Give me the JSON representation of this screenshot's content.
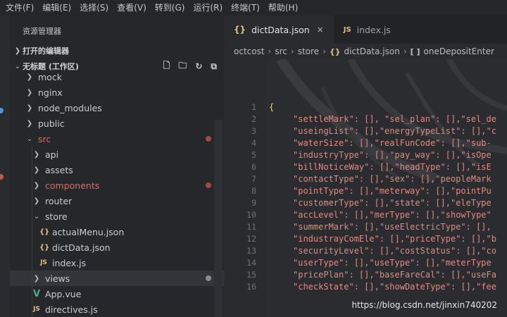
{
  "menu": [
    "文件(F)",
    "编辑(E)",
    "选择(S)",
    "查看(V)",
    "转到(G)",
    "运行(R)",
    "终端(T)",
    "帮助(H)"
  ],
  "sidebar": {
    "title": "资源管理器",
    "open_editors": "打开的编辑器",
    "workspace": "无标题 (工作区)",
    "tree": [
      {
        "label": "mock",
        "kind": "folder",
        "depth": 0,
        "expanded": false
      },
      {
        "label": "nginx",
        "kind": "folder",
        "depth": 0,
        "expanded": false
      },
      {
        "label": "node_modules",
        "kind": "folder",
        "depth": 0,
        "expanded": false
      },
      {
        "label": "public",
        "kind": "folder",
        "depth": 0,
        "expanded": false
      },
      {
        "label": "src",
        "kind": "folder",
        "depth": 0,
        "expanded": true,
        "modified": true
      },
      {
        "label": "api",
        "kind": "folder",
        "depth": 1,
        "expanded": false
      },
      {
        "label": "assets",
        "kind": "folder",
        "depth": 1,
        "expanded": false
      },
      {
        "label": "components",
        "kind": "folder",
        "depth": 1,
        "expanded": false,
        "modified": true
      },
      {
        "label": "router",
        "kind": "folder",
        "depth": 1,
        "expanded": false
      },
      {
        "label": "store",
        "kind": "folder",
        "depth": 1,
        "expanded": true
      },
      {
        "label": "actualMenu.json",
        "kind": "json",
        "depth": 2
      },
      {
        "label": "dictData.json",
        "kind": "json",
        "depth": 2
      },
      {
        "label": "index.js",
        "kind": "js",
        "depth": 2
      },
      {
        "label": "views",
        "kind": "folder",
        "depth": 1,
        "expanded": false,
        "selected": true,
        "dot": true
      },
      {
        "label": "App.vue",
        "kind": "vue",
        "depth": 1
      },
      {
        "label": "directives.js",
        "kind": "js",
        "depth": 1
      }
    ]
  },
  "tabs": [
    {
      "label": "dictData.json",
      "icon": "json-icon",
      "active": true,
      "close": "×"
    },
    {
      "label": "index.js",
      "icon": "js-icon",
      "active": false
    }
  ],
  "breadcrumb": [
    "octcost",
    "src",
    "store",
    "dictData.json",
    "oneDepositEnter"
  ],
  "code": {
    "line_numbers": [
      "1",
      "2",
      "3",
      "4",
      "5",
      "6",
      "7",
      "8",
      "9",
      "10",
      "11",
      "12",
      "13",
      "14",
      "15",
      "16"
    ],
    "lines": [
      {
        "t": "{",
        "brace": true
      },
      {
        "t": "\"settleMark\": [], \"sel_plan\": [],\"sel_de"
      },
      {
        "t": "\"useingList\": [],\"energyTypeList\": [],\"c"
      },
      {
        "t": "\"waterSize\": [],\"realFunCode\": [],\"sub-"
      },
      {
        "t": "\"industryType\": [],\"pay_way\": [],\"isOpe"
      },
      {
        "t": "\"billNoticeWay\": [],\"headType\": [],\"isE"
      },
      {
        "t": "\"contactType\": [],\"sex\": [],\"peopleMark"
      },
      {
        "t": "\"pointType\": [],\"meterway\": [],\"pointPu"
      },
      {
        "t": "\"customerType\": [],\"state\": [],\"eleType"
      },
      {
        "t": "\"accLevel\": [],\"merType\": [],\"showType\""
      },
      {
        "t": "\"summerMark\": [],\"useElectricType\": [],"
      },
      {
        "t": "\"industrayComEle\": [],\"priceType\": [],\"b"
      },
      {
        "t": "\"securityLevel\": [],\"costStatus\": [],\"co"
      },
      {
        "t": "\"userType\": [],\"useType\": [],\"meterType"
      },
      {
        "t": "\"pricePlan\": [],\"baseFareCal\": [],\"useFa"
      },
      {
        "t": "\"checkState\": [],\"showDateType\": [],\"fee"
      }
    ]
  },
  "watermark": "https://blog.csdn.net/jinxin740202",
  "colors": {
    "accent": "#e5c07b",
    "modified": "#e06c5a",
    "key": "#e08a84"
  }
}
